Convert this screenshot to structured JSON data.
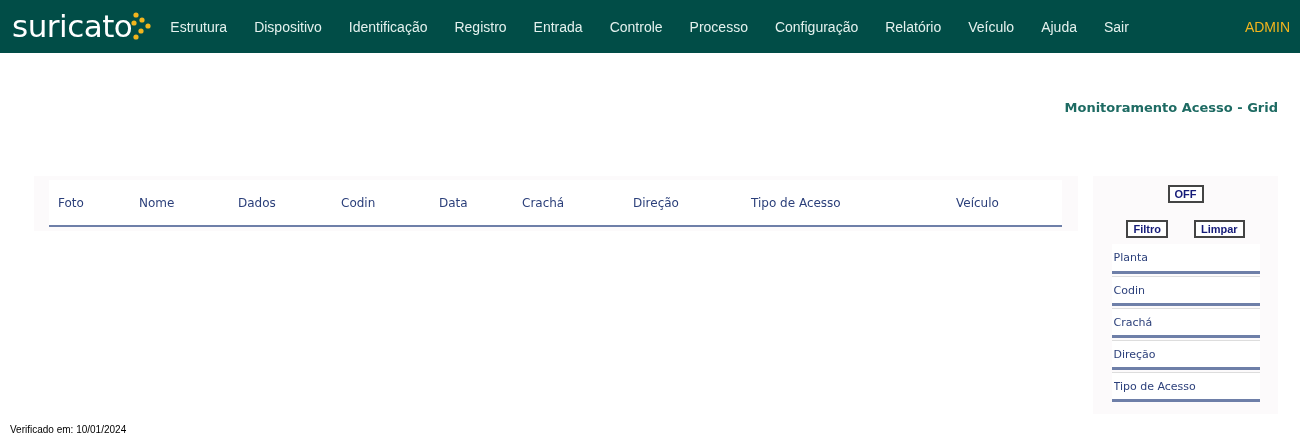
{
  "logo": {
    "text": "suricato"
  },
  "menu": [
    "Estrutura",
    "Dispositivo",
    "Identificação",
    "Registro",
    "Entrada",
    "Controle",
    "Processo",
    "Configuração",
    "Relatório",
    "Veículo",
    "Ajuda",
    "Sair"
  ],
  "user": "ADMIN",
  "page_title": "Monitoramento Acesso - Grid",
  "table": {
    "columns": [
      "Foto",
      "Nome",
      "Dados",
      "Codin",
      "Data",
      "Crachá",
      "Direção",
      "Tipo de Acesso",
      "Veículo"
    ]
  },
  "filter_panel": {
    "toggle": "OFF",
    "buttons": [
      "Filtro",
      "Limpar"
    ],
    "fields": [
      {
        "placeholder": "Planta"
      },
      {
        "placeholder": "Codin"
      },
      {
        "placeholder": "Crachá"
      },
      {
        "placeholder": "Direção"
      },
      {
        "placeholder": "Tipo de Acesso"
      }
    ]
  },
  "footer": "Verificado em: 10/01/2024"
}
